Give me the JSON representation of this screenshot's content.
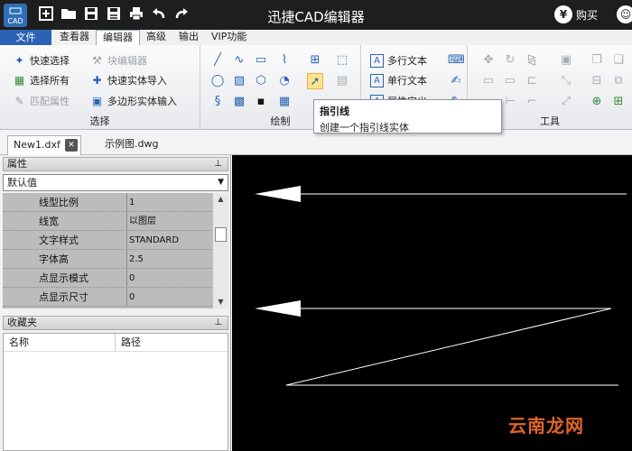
{
  "titlebar": {
    "logo_text": "CAD",
    "title": "迅捷CAD编辑器",
    "buy_label": "购买",
    "buy_symbol": "¥",
    "icons": [
      "new-icon",
      "open-folder-icon",
      "save-icon",
      "save-as-icon",
      "print-icon",
      "undo-icon",
      "redo-icon"
    ]
  },
  "menu": {
    "file": "文件",
    "tabs": [
      "查看器",
      "编辑器",
      "高级",
      "输出",
      "VIP功能"
    ],
    "active_tab": "编辑器"
  },
  "ribbon": {
    "select_group": {
      "label": "选择",
      "items": [
        "快速选择",
        "选择所有",
        "匹配属性",
        "块编辑器",
        "快速实体导入",
        "多边形实体输入"
      ]
    },
    "draw_group": {
      "label": "绘制"
    },
    "text_group": {
      "items": [
        "多行文本",
        "单行文本",
        "属性定义"
      ]
    },
    "tools_group": {
      "label": "工具"
    }
  },
  "tooltip": {
    "title": "指引线",
    "desc": "创建一个指引线实体"
  },
  "doc_tabs": [
    "New1.dxf",
    "示例图.dwg"
  ],
  "properties_panel": {
    "title": "属性",
    "combo_value": "默认值",
    "rows": [
      {
        "name": "线型比例",
        "value": "1"
      },
      {
        "name": "线宽",
        "value": "以图层"
      },
      {
        "name": "文字样式",
        "value": "STANDARD"
      },
      {
        "name": "字体高",
        "value": "2.5"
      },
      {
        "name": "点显示模式",
        "value": "0"
      },
      {
        "name": "点显示尺寸",
        "value": "0"
      }
    ]
  },
  "favorites_panel": {
    "title": "收藏夹",
    "col_name": "名称",
    "col_path": "路径"
  },
  "watermark": "云南龙网",
  "colors": {
    "titlebar": "#1e1e1e",
    "file_menu": "#2b62b5",
    "canvas": "#000000",
    "watermark": "#e0642a"
  }
}
